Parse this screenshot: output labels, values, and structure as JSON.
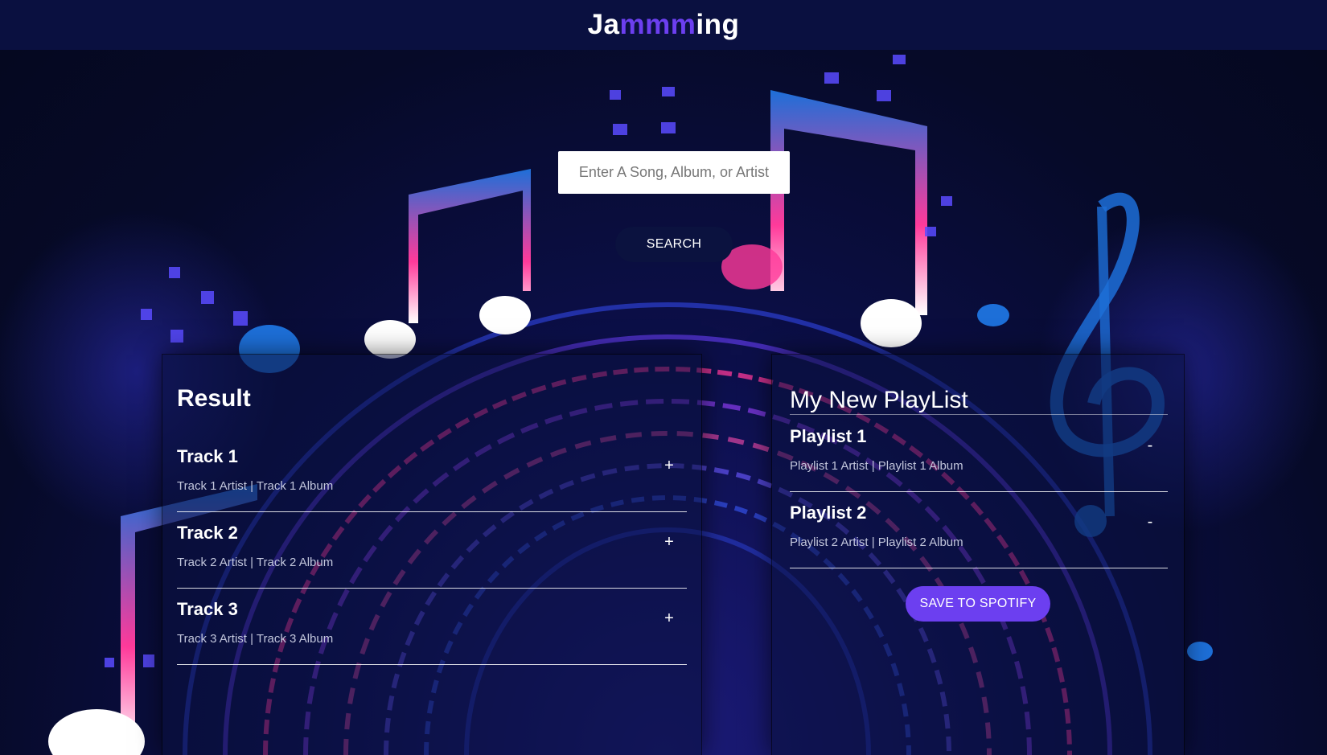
{
  "app": {
    "logo_start": "Ja",
    "logo_highlight": "mmm",
    "logo_end": "ing"
  },
  "search": {
    "placeholder": "Enter A Song, Album, or Artist",
    "button_label": "SEARCH"
  },
  "results": {
    "title": "Result",
    "add_symbol": "+",
    "tracks": [
      {
        "name": "Track 1",
        "meta": "Track 1 Artist | Track 1 Album"
      },
      {
        "name": "Track 2",
        "meta": "Track 2 Artist | Track 2 Album"
      },
      {
        "name": "Track 3",
        "meta": "Track 3 Artist | Track 3 Album"
      }
    ]
  },
  "playlist": {
    "title": "My New PlayList",
    "remove_symbol": "-",
    "tracks": [
      {
        "name": "Playlist 1",
        "meta": "Playlist 1 Artist | Playlist 1 Album"
      },
      {
        "name": "Playlist 2",
        "meta": "Playlist 2 Artist | Playlist 2 Album"
      }
    ],
    "save_label": "SAVE TO SPOTIFY"
  },
  "colors": {
    "accent": "#6c3ff0",
    "header_bg": "#0a1040",
    "page_bg": "#050a24"
  }
}
